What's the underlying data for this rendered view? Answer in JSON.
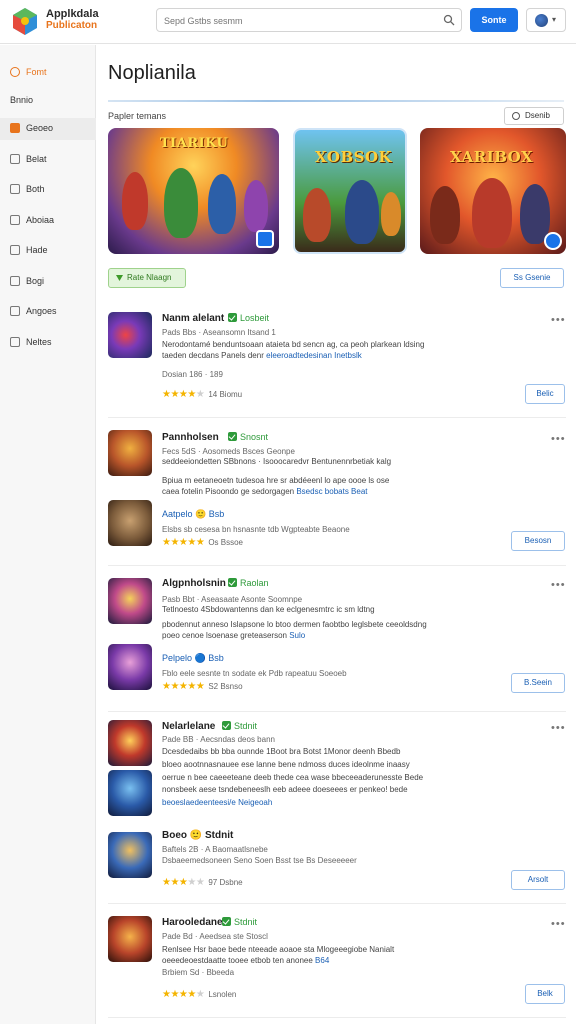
{
  "header": {
    "brand_line1": "Applkdala",
    "brand_line2": "Publicaton",
    "search_placeholder": "Sepd Gstbs sesmm",
    "search_button": "Sonte"
  },
  "sidebar": {
    "items": [
      {
        "label": "Fomt"
      },
      {
        "label": "Bnnio"
      },
      {
        "label": "Geoeo"
      },
      {
        "label": "Belat"
      },
      {
        "label": "Both"
      },
      {
        "label": "Aboiaa"
      },
      {
        "label": "Hade"
      },
      {
        "label": "Bogi"
      },
      {
        "label": "Angoes"
      },
      {
        "label": "Neltes"
      }
    ]
  },
  "main": {
    "title": "Noplianila",
    "section_label": "Papler temans",
    "section_button": "Dsenib",
    "banners": [
      {
        "text": "TIARIKU"
      },
      {
        "text": "XOBSOK"
      },
      {
        "text": "XARIBOX"
      }
    ],
    "filter_chip": "Rate Nlaagn",
    "right_button": "Ss Gsenie"
  },
  "entries": [
    {
      "name": "Nanm alelant",
      "verified": "Losbeit",
      "meta": "Pads Bbs · Aseansomn Itsand 1",
      "desc1": "Nerodontamé benduntsoaan ataieta bd sencn ag, ca peoh plarkean ldsing",
      "desc2": "taeden decdans Panels denr",
      "desc2_link": "eleeroadtedesinan Inetbslk",
      "sub_meta": "Dosian 186 · 189",
      "rating": "4",
      "count": "14 Biomu",
      "action": "Belic"
    },
    {
      "name": "Pannholsen",
      "verified": "Snosnt",
      "meta": "Fecs 5dS · Aosomeds Bsces Geonpe",
      "desc1": "seddeeiondetten SBbnons · Isooocaredvr Bentunennrbetiak kalg",
      "desc2": "Bpiua m eetaneoetn tudesoa hre sr abdéeenl lo ape oooe ls ose",
      "desc3": "caea fotelin Pisoondo ge sedorgagen",
      "desc3_link": "Bsedsc bobats Beat",
      "sub_title": "Aatpelo 🙂 Bsb",
      "sub_desc": "Elsbs sb cesesa bn hsnasnte tdb Wgpteabte Beaone",
      "rating": "4.5",
      "count": "Os Bssoe",
      "action": "Besosn"
    },
    {
      "name": "Algpnholsnin",
      "verified": "Raolan",
      "meta": "Pasb Bbt · Aseasaate Asonte Soomnpe",
      "desc1": "Tetlnoesto 4Sbdowantenns dan ke eclgenesmtrc ic sm ldtng",
      "desc2": "pbodennut anneso Islapsone lo btoo dermen faobtbo leglsbete ceeoldsdng",
      "desc3": "poeo cenoe lsoenase greteaserson",
      "desc3_link": "Sulo",
      "sub_title": "Pelpelo 🔵 Bsb",
      "sub_desc": "Fblo eele sesnte tn sodate ek Pdb rapeatuu Soeoeb",
      "rating": "4.5",
      "count": "S2 Bsnso",
      "action": "B.Seein"
    },
    {
      "name": "Nelarlelane",
      "verified": "Stdnit",
      "meta": "Pade BB · Aecsndas deos bann",
      "desc1": "Dcesdedaibs bb bba ounnde 1Boot bra Botst 1Monor deenh Bbedb",
      "desc2": "bloeo aootnnasnauee ese lanne bene ndmoss duces ideolnme inaasy",
      "desc3": "oerrue n bee caeeeteane deeb thede cea wase bbeceeaderunesste Bede",
      "desc4": "nonsbeek aese tsndebeneeslh eeb adeee doeseees er penkeo! bede",
      "desc5_link": "beoeslaedeenteesi/e Neigeoah",
      "sub_title": "Boeo 🙂 Stdnit",
      "sub_meta": "Baftels 2B · A Baomaatlsnebe",
      "sub_desc": "Dsbaeemedsoneen Seno Soen Bsst tse Bs Deseeeeer",
      "rating": "3.5",
      "count": "97 Dsbne",
      "action": "Arsolt"
    },
    {
      "name": "Harooledane",
      "verified": "Stdnit",
      "meta": "Pade Bd · Aeedsea ste Stoscl",
      "desc1": "Renlsee Hsr baoe bede nteeade aoaoe sta Mlogeeegiobe Nanialt",
      "desc2": "oeeedeoestdaatte tooee etbob ten anonee",
      "desc2_link": "B64",
      "sub_meta": "Brbiem Sd · Bbeeda",
      "rating": "4",
      "count": "Lsnolen",
      "action": "Belk"
    }
  ]
}
